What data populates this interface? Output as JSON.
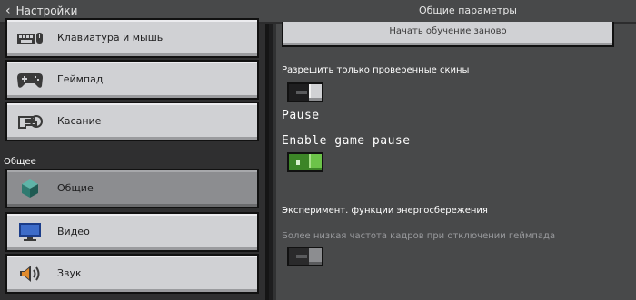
{
  "header": {
    "back_label": "Настройки",
    "title": "Общие параметры"
  },
  "sidebar": {
    "items_top": [
      {
        "label": "Клавиатура и мышь",
        "icon": "keyboard-mouse-icon"
      },
      {
        "label": "Геймпад",
        "icon": "gamepad-icon"
      },
      {
        "label": "Касание",
        "icon": "touch-icon"
      }
    ],
    "section_label": "Общее",
    "items_general": [
      {
        "label": "Общие",
        "icon": "cube-icon",
        "selected": true
      },
      {
        "label": "Видео",
        "icon": "monitor-icon"
      },
      {
        "label": "Звук",
        "icon": "speaker-icon"
      }
    ]
  },
  "main": {
    "restart_tutorial_label": "Начать обучение заново",
    "verified_skins": {
      "label": "Разрешить только проверенные скины",
      "enabled": false
    },
    "pause_heading": "Pause",
    "enable_game_pause": {
      "label": "Enable game pause",
      "enabled": true
    },
    "experimental_power_label": "Эксперимент. функции энергосбережения",
    "lower_framerate": {
      "label": "Более низкая частота кадров при отключении геймпада",
      "enabled": false,
      "disabled": true
    }
  },
  "colors": {
    "toggle_on": "#3c8527",
    "panel_bg": "#48494a",
    "sidebar_bg": "#2f2f30",
    "button_bg": "#d0d1d4",
    "selected_button_bg": "#8c8d90"
  }
}
